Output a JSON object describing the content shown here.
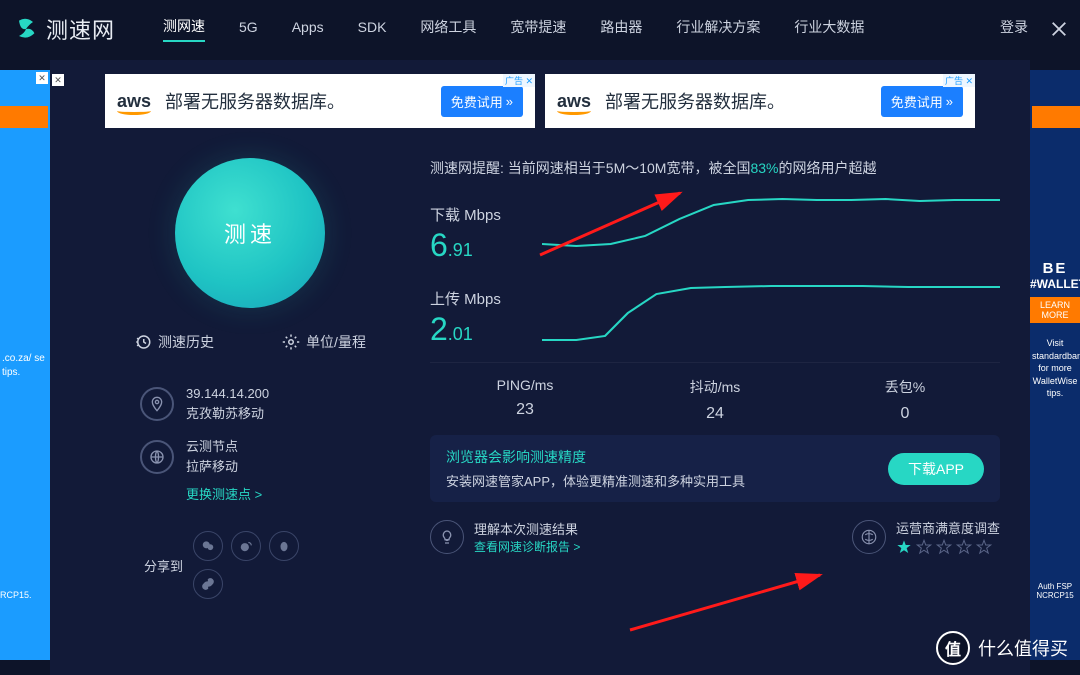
{
  "header": {
    "logo_text": "测速网",
    "nav": [
      "测网速",
      "5G",
      "Apps",
      "SDK",
      "网络工具",
      "宽带提速",
      "路由器",
      "行业解决方案",
      "行业大数据"
    ],
    "login": "登录"
  },
  "ads": {
    "top": {
      "brand": "aws",
      "text": "部署无服务器数据库。",
      "cta": "免费试用",
      "label": "广告"
    },
    "left": {
      "text": ".co.za/\nse\ntips."
    },
    "right": {
      "be": "BE",
      "tag": "#WALLETWISE",
      "learn": "LEARN MORE",
      "desc": "Visit standardbank.co.za/walletwise for more WalletWise tips.",
      "foot": "Auth FSP NCRCP15"
    }
  },
  "left_panel": {
    "speed_btn": "测速",
    "history": "测速历史",
    "units": "单位/量程",
    "ip": "39.144.14.200",
    "isp": "克孜勒苏移动",
    "node_t": "云测节点",
    "node_n": "拉萨移动",
    "change": "更换测速点 >",
    "share": "分享到"
  },
  "alert": {
    "prefix": "测速网提醒:",
    "body1": "当前网速相当于5M～10M宽带，被全国",
    "pct": "83%",
    "body2": "的网络用户超越"
  },
  "charts": {
    "download": {
      "label": "下载 Mbps",
      "int": "6",
      "dec": ".91"
    },
    "upload": {
      "label": "上传 Mbps",
      "int": "2",
      "dec": ".01"
    }
  },
  "metrics": [
    {
      "label": "PING/ms",
      "value": "23"
    },
    {
      "label": "抖动/ms",
      "value": "24"
    },
    {
      "label": "丢包%",
      "value": "0"
    }
  ],
  "tip": {
    "title": "浏览器会影响测速精度",
    "sub": "安装网速管家APP，体验更精准测速和多种实用工具",
    "btn": "下载APP"
  },
  "bottom": {
    "understand1": "理解本次测速结果",
    "understand2": "查看网速诊断报告 >",
    "survey": "运营商满意度调查"
  },
  "watermark": "什么值得买",
  "chart_data": [
    {
      "type": "line",
      "title": "下载 Mbps",
      "series": [
        {
          "name": "download",
          "values": [
            3.0,
            2.8,
            3.0,
            3.9,
            5.8,
            7.6,
            8.3,
            8.4,
            8.3,
            8.3,
            8.4,
            8.2,
            8.3,
            8.2,
            8.3
          ]
        }
      ],
      "ylim": [
        0,
        10
      ],
      "xlabel": "",
      "ylabel": "Mbps"
    },
    {
      "type": "line",
      "title": "上传 Mbps",
      "series": [
        {
          "name": "upload",
          "values": [
            0.3,
            0.3,
            0.4,
            1.3,
            2.2,
            2.5,
            2.55,
            2.6,
            2.6,
            2.6,
            2.6,
            2.55,
            2.55,
            2.55,
            2.55
          ]
        }
      ],
      "ylim": [
        0,
        3
      ],
      "xlabel": "",
      "ylabel": "Mbps"
    }
  ]
}
